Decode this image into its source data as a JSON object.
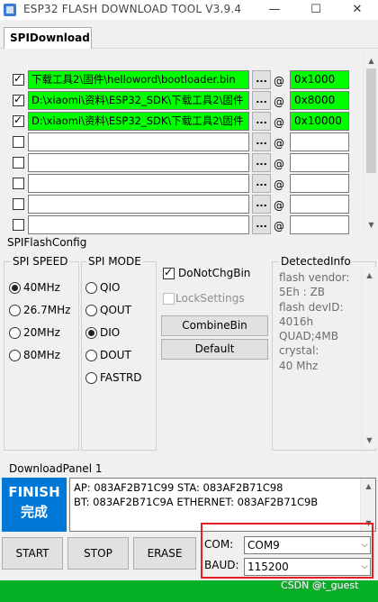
{
  "window": {
    "title": "ESP32 FLASH DOWNLOAD TOOL V3.9.4",
    "minimize": "—",
    "maximize": "☐",
    "close": "✕"
  },
  "tabs": [
    {
      "label": "SPIDownload"
    }
  ],
  "file_rows": [
    {
      "checked": true,
      "path": "下载工具2\\固件\\helloword\\bootloader.bin",
      "address": "0x1000",
      "highlight": true
    },
    {
      "checked": true,
      "path": "D:\\xiaomi\\资料\\ESP32_SDK\\下载工具2\\固件",
      "address": "0x8000",
      "highlight": true
    },
    {
      "checked": true,
      "path": "D:\\xiaomi\\资料\\ESP32_SDK\\下载工具2\\固件",
      "address": "0x10000",
      "highlight": true
    },
    {
      "checked": false,
      "path": "",
      "address": "",
      "highlight": false
    },
    {
      "checked": false,
      "path": "",
      "address": "",
      "highlight": false
    },
    {
      "checked": false,
      "path": "",
      "address": "",
      "highlight": false
    },
    {
      "checked": false,
      "path": "",
      "address": "",
      "highlight": false
    },
    {
      "checked": false,
      "path": "",
      "address": "",
      "highlight": false
    }
  ],
  "browse_label": "...",
  "at_label": "@",
  "spi_config": {
    "title": "SPIFlashConfig",
    "speed": {
      "label": "SPI SPEED",
      "options": [
        "40MHz",
        "26.7MHz",
        "20MHz",
        "80MHz"
      ],
      "selected": "40MHz"
    },
    "mode": {
      "label": "SPI MODE",
      "options": [
        "QIO",
        "QOUT",
        "DIO",
        "DOUT",
        "FASTRD"
      ],
      "selected": "DIO"
    },
    "do_not_chg_bin": {
      "label": "DoNotChgBin",
      "checked": true
    },
    "lock_settings": {
      "label": "LockSettings",
      "checked": false
    },
    "combine_label": "CombineBin",
    "default_label": "Default"
  },
  "detected_info": {
    "title": "DetectedInfo",
    "lines": [
      "flash vendor:",
      "5Eh : ZB",
      "flash devID:",
      "4016h",
      "QUAD;4MB",
      "crystal:",
      "40 Mhz"
    ]
  },
  "download_panel": {
    "title": "DownloadPanel 1",
    "status_line1": "FINISH",
    "status_line2": "完成",
    "log_line1": "AP:  083AF2B71C99  STA:  083AF2B71C98",
    "log_line2": "BT:  083AF2B71C9A  ETHERNET:  083AF2B71C9B",
    "start_label": "START",
    "stop_label": "STOP",
    "erase_label": "ERASE",
    "com_label": "COM:",
    "com_value": "COM9",
    "baud_label": "BAUD:",
    "baud_value": "115200",
    "progress": 1.0
  },
  "watermark": "CSDN @t_guest",
  "colors": {
    "highlight": "#00ff00",
    "finish_bg": "#0078d7",
    "progress": "#06b025",
    "annotation_box": "#e31e24"
  }
}
